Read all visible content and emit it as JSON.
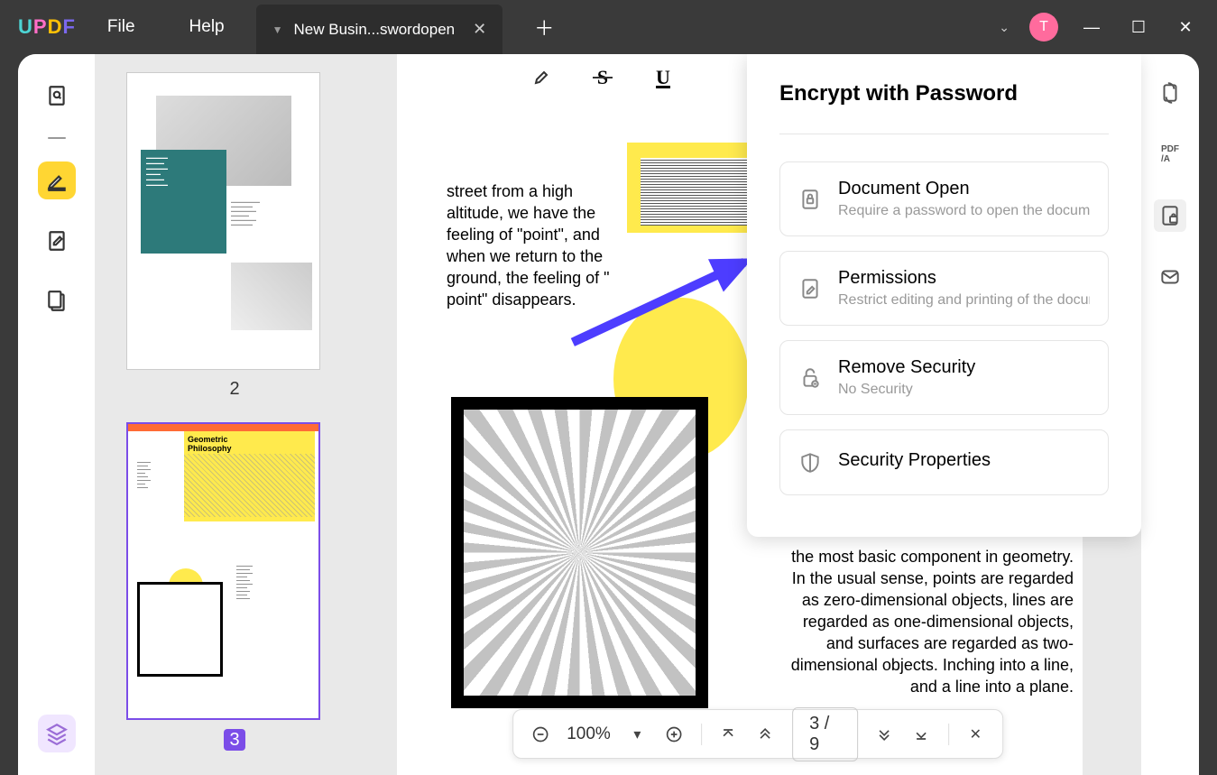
{
  "logo": {
    "u": "U",
    "p": "P",
    "d": "D",
    "f": "F"
  },
  "menu": {
    "file": "File",
    "help": "Help"
  },
  "tab": {
    "title": "New Busin...swordopen"
  },
  "avatar": "T",
  "thumbs": {
    "page2": "2",
    "page3": "3",
    "t3_title": "Geometric\nPhilosophy"
  },
  "doc": {
    "text1": "street from a high altitude, we have the feeling of \"point\", and when we return to the ground, the feeling of \" point\" disappears.",
    "text2": "the most basic component in geometry. In the usual sense, points are regarded as zero-dimensional objects, lines are regarded as one-dimensional objects, and surfaces are regarded as two-dimensional objects. Inching into a line, and a line into a plane."
  },
  "encrypt": {
    "title": "Encrypt with Password",
    "items": [
      {
        "label": "Document Open",
        "desc": "Require a password to open the document"
      },
      {
        "label": "Permissions",
        "desc": "Restrict editing and printing of the document"
      },
      {
        "label": "Remove Security",
        "desc": "No Security"
      },
      {
        "label": "Security Properties",
        "desc": ""
      }
    ]
  },
  "bottombar": {
    "zoom": "100%",
    "page": "3  /  9"
  }
}
